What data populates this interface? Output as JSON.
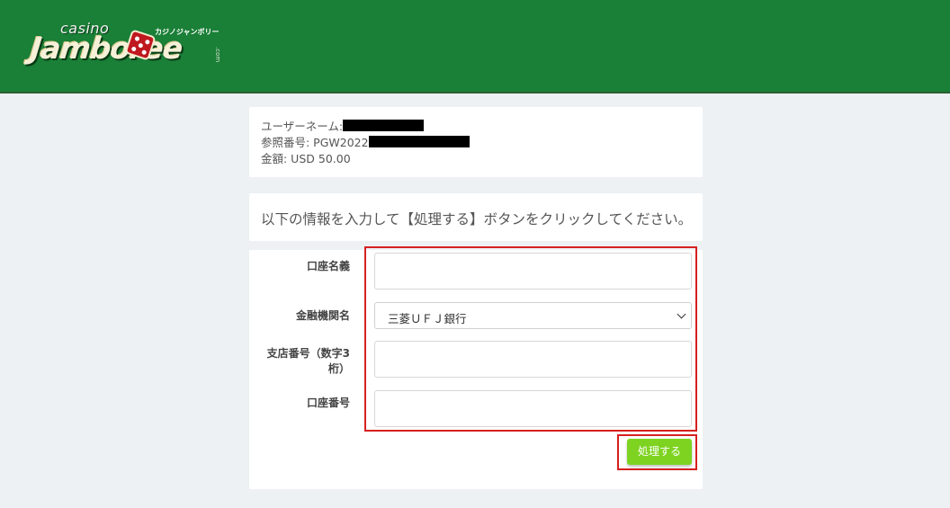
{
  "header": {
    "logo_small": "casino",
    "logo_word": "Jamboree",
    "logo_kana": "カジノジャンボリー",
    "logo_suffix": ".com",
    "brand_color": "#1a7f37"
  },
  "info": {
    "username_label": "ユーザーネーム:",
    "reference_label": "参照番号: PGW2022",
    "amount_text": "金額: USD 50.00"
  },
  "form": {
    "instruction": "以下の情報を入力して【処理する】ボタンをクリックしてください。",
    "account_name_label": "口座名義",
    "account_name_value": "",
    "bank_label": "金融機関名",
    "bank_selected": "三菱ＵＦＪ銀行",
    "branch_label": "支店番号（数字3桁）",
    "branch_value": "",
    "account_number_label": "口座番号",
    "account_number_value": "",
    "submit_label": "処理する",
    "submit_color": "#7ed321",
    "highlight_color": "#d62020"
  }
}
